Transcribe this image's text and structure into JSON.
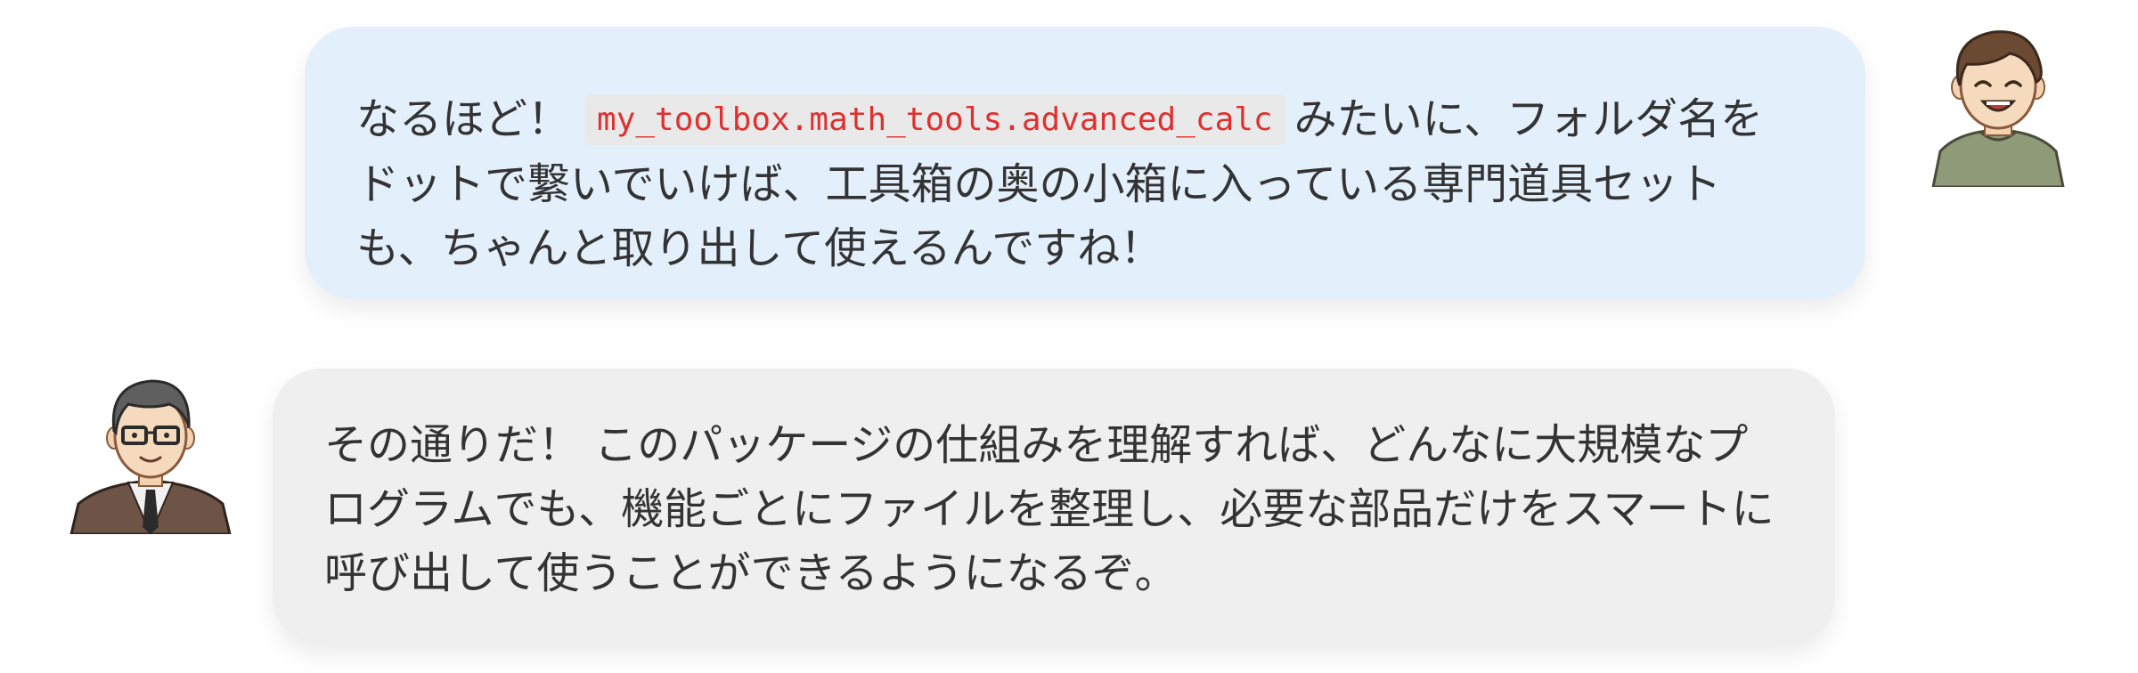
{
  "conversation": {
    "user_message": {
      "text_before_code": "なるほど！",
      "code": "my_toolbox.math_tools.advanced_calc",
      "text_after_code": "みたいに、フォルダ名をドットで繋いでいけば、工具箱の奥の小箱に入っている専門道具セットも、ちゃんと取り出して使えるんですね！"
    },
    "mentor_message": {
      "text": "その通りだ！ このパッケージの仕組みを理解すれば、どんなに大規模なプログラムでも、機能ごとにファイルを整理し、必要な部品だけをスマートに呼び出して使うことができるようになるぞ。"
    },
    "user_avatar": "smiling-young-man-avatar",
    "mentor_avatar": "glasses-teacher-avatar",
    "colors": {
      "user_bubble": "#e3f0fc",
      "mentor_bubble": "#efefef",
      "code_text": "#e0302e",
      "code_bg": "#e9e9ea",
      "text": "#333333"
    }
  }
}
